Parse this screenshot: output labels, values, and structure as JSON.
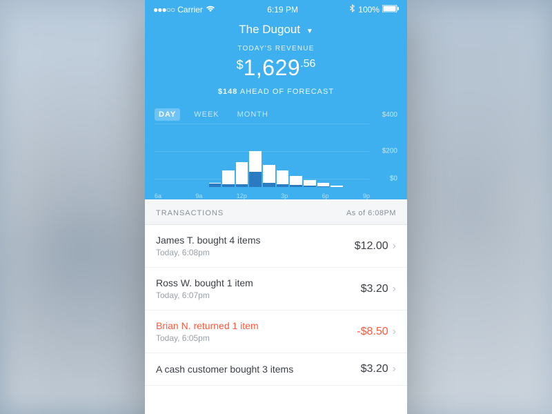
{
  "status": {
    "dots": "●●●○○",
    "carrier": "Carrier",
    "time": "6:19 PM",
    "battery_pct": "100%"
  },
  "header": {
    "title": "The Dugout",
    "label": "TODAY'S REVENUE",
    "currency": "$",
    "amount_major": "1,629",
    "amount_cents": ".56",
    "forecast_amount": "$148",
    "forecast_text": "AHEAD OF FORECAST"
  },
  "tabs": {
    "items": [
      "DAY",
      "WEEK",
      "MONTH"
    ],
    "active": 0
  },
  "chart_data": {
    "type": "bar",
    "categories": [
      "6a",
      "",
      "",
      "9a",
      "",
      "",
      "12p",
      "",
      "",
      "3p",
      "",
      "",
      "6p",
      "",
      "",
      "9p"
    ],
    "x_labels": [
      "6a",
      "9a",
      "12p",
      "3p",
      "6p",
      "9p"
    ],
    "series": [
      {
        "name": "primary",
        "values": [
          0,
          0,
          0,
          0,
          30,
          120,
          180,
          260,
          160,
          120,
          80,
          50,
          30,
          10,
          0,
          0
        ]
      },
      {
        "name": "secondary",
        "values": [
          0,
          0,
          0,
          0,
          25,
          20,
          20,
          110,
          30,
          20,
          15,
          10,
          5,
          0,
          0,
          0
        ]
      }
    ],
    "ylabel": "",
    "ylim": [
      0,
      400
    ],
    "yticks": [
      "$400",
      "$200",
      "$0"
    ]
  },
  "transactions": {
    "heading": "TRANSACTIONS",
    "asof": "As of 6:08PM",
    "items": [
      {
        "title": "James T. bought 4 items",
        "time": "Today, 6:08pm",
        "amount": "$12.00",
        "negative": false
      },
      {
        "title": "Ross W. bought 1 item",
        "time": "Today, 6:07pm",
        "amount": "$3.20",
        "negative": false
      },
      {
        "title": "Brian N. returned 1 item",
        "time": "Today, 6:05pm",
        "amount": "-$8.50",
        "negative": true
      },
      {
        "title": "A cash customer bought 3 items",
        "time": "",
        "amount": "$3.20",
        "negative": false
      }
    ]
  },
  "colors": {
    "accent": "#3eb0f0",
    "negative": "#ff5a3c"
  }
}
